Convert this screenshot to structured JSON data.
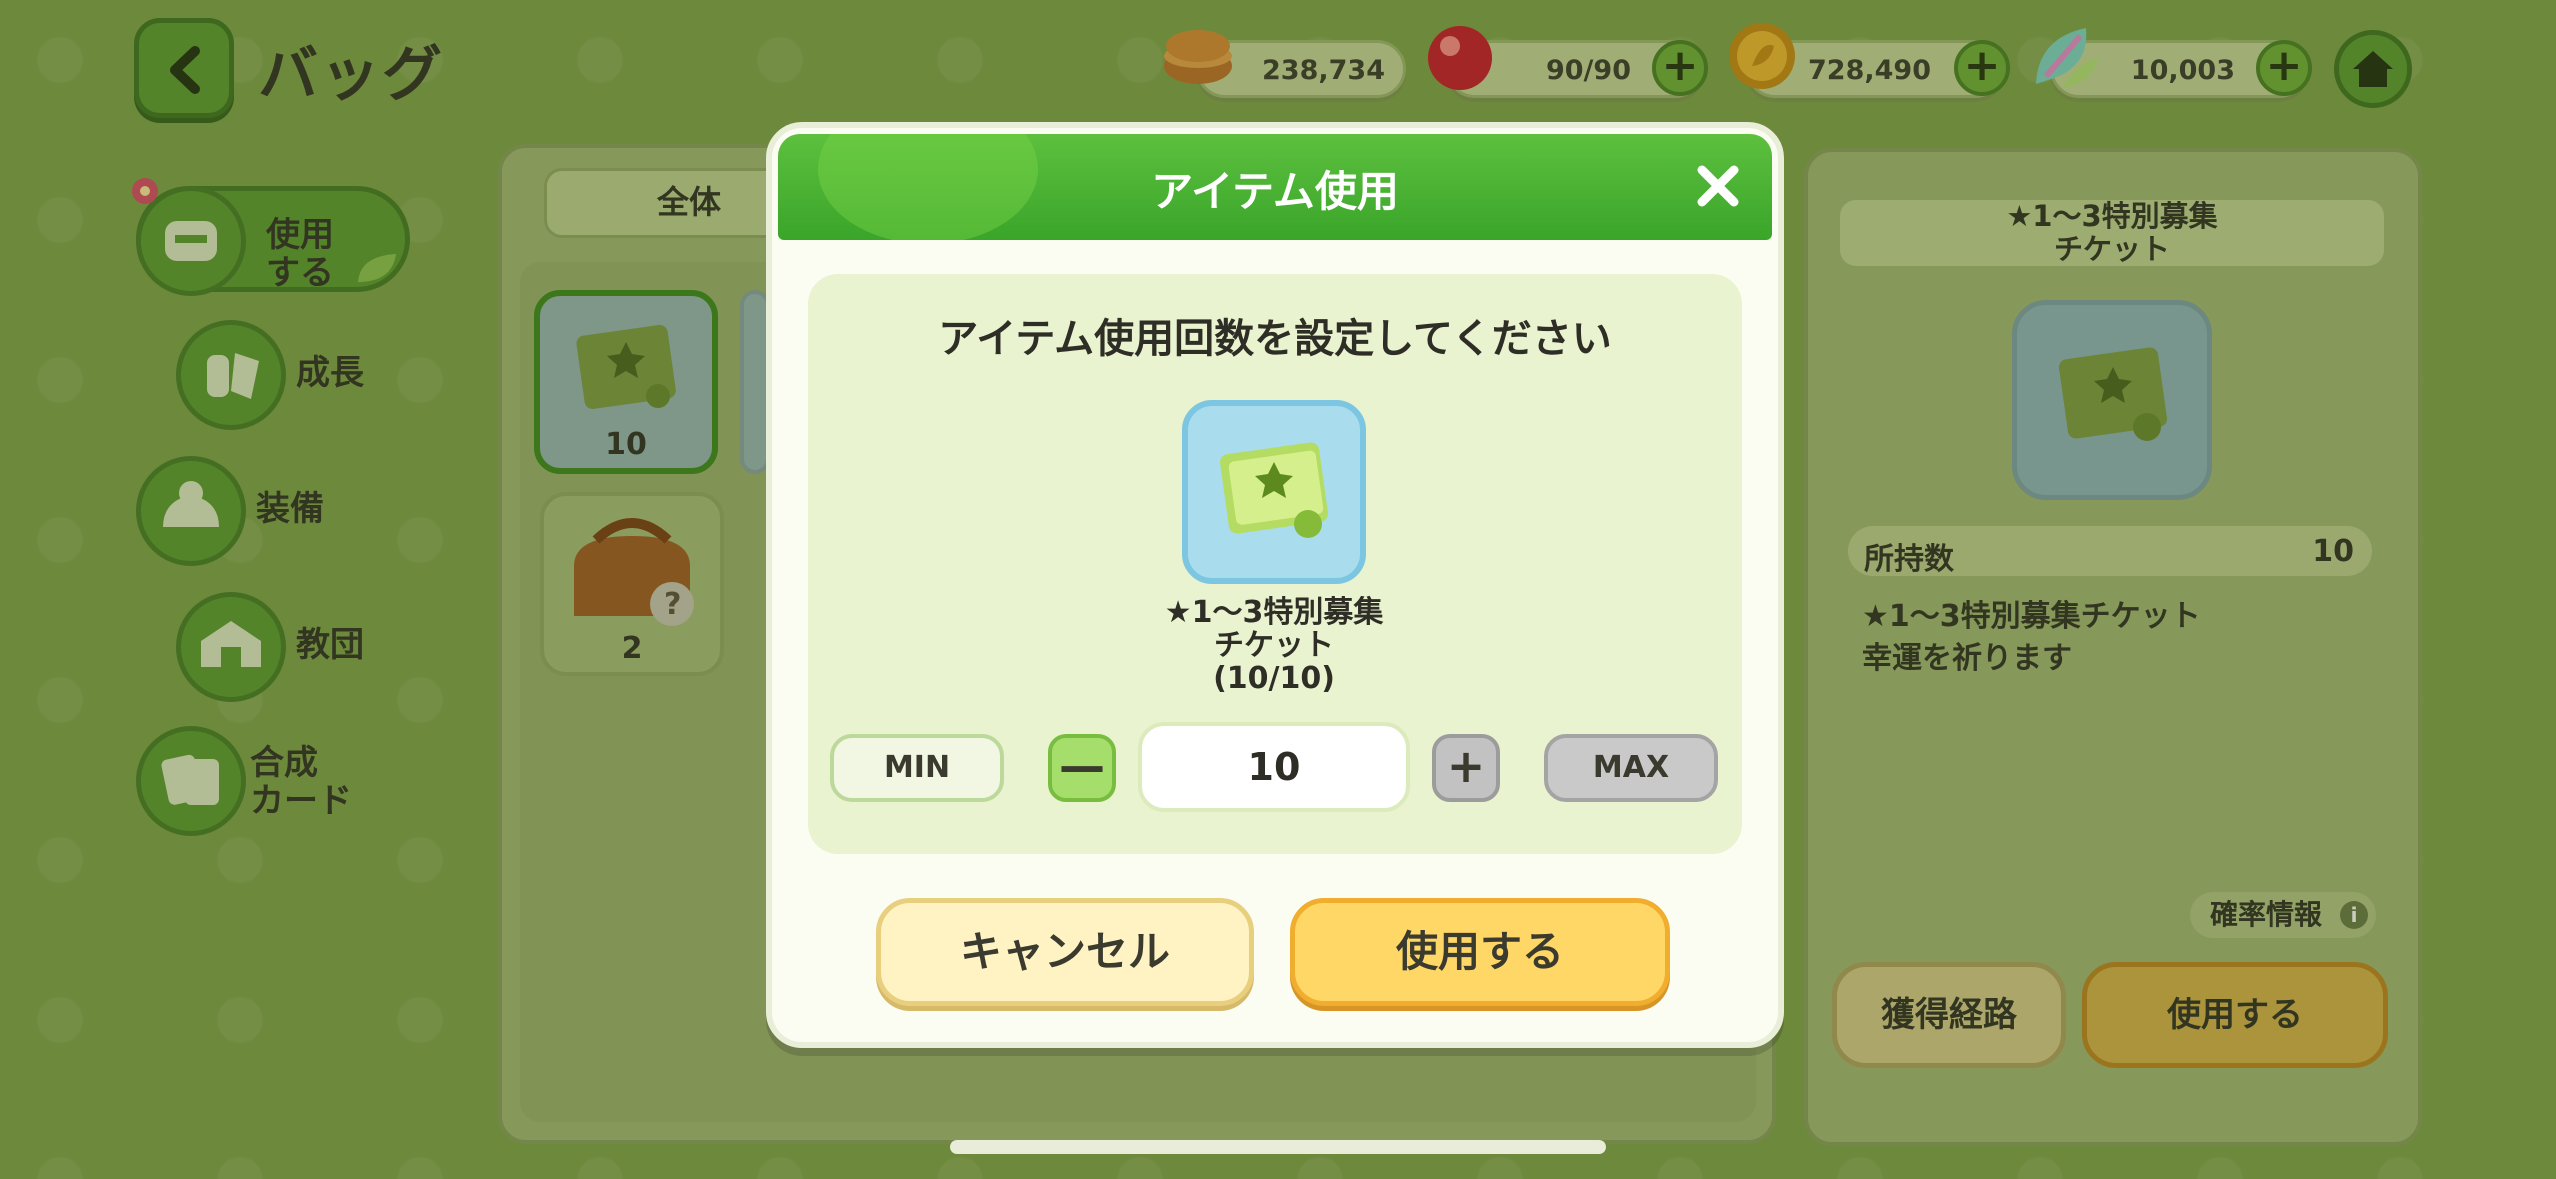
{
  "header": {
    "title": "バッグ",
    "resources": [
      {
        "name": "food",
        "value": "238,734"
      },
      {
        "name": "stamina",
        "value": "90/90"
      },
      {
        "name": "coin",
        "value": "728,490"
      },
      {
        "name": "leaf",
        "value": "10,003"
      }
    ]
  },
  "sidebar": {
    "items": [
      {
        "label": "使用\nする"
      },
      {
        "label": "成長"
      },
      {
        "label": "装備"
      },
      {
        "label": "教団"
      },
      {
        "label": "合成\nカード"
      }
    ]
  },
  "inventory": {
    "tab_label": "全体",
    "items": [
      {
        "name": "ticket",
        "count": "10"
      },
      {
        "name": "bag",
        "count": "2"
      }
    ]
  },
  "detail": {
    "title": "★1〜3特別募集\nチケット",
    "owned_label": "所持数",
    "owned_value": "10",
    "description": "★1〜3特別募集チケット\n幸運を祈ります",
    "rate_info_label": "確率情報",
    "source_button": "獲得経路",
    "use_button": "使用する"
  },
  "modal": {
    "title": "アイテム使用",
    "prompt": "アイテム使用回数を設定してください",
    "item_name": "★1〜3特別募集\nチケット\n(10/10)",
    "min_label": "MIN",
    "max_label": "MAX",
    "minus_label": "—",
    "plus_label": "+",
    "quantity": "10",
    "cancel_label": "キャンセル",
    "confirm_label": "使用する"
  },
  "colors": {
    "background": "#80a14a",
    "modal_header": "#3aa52a",
    "confirm_button": "#ffd766",
    "cancel_button": "#fff3c4"
  }
}
